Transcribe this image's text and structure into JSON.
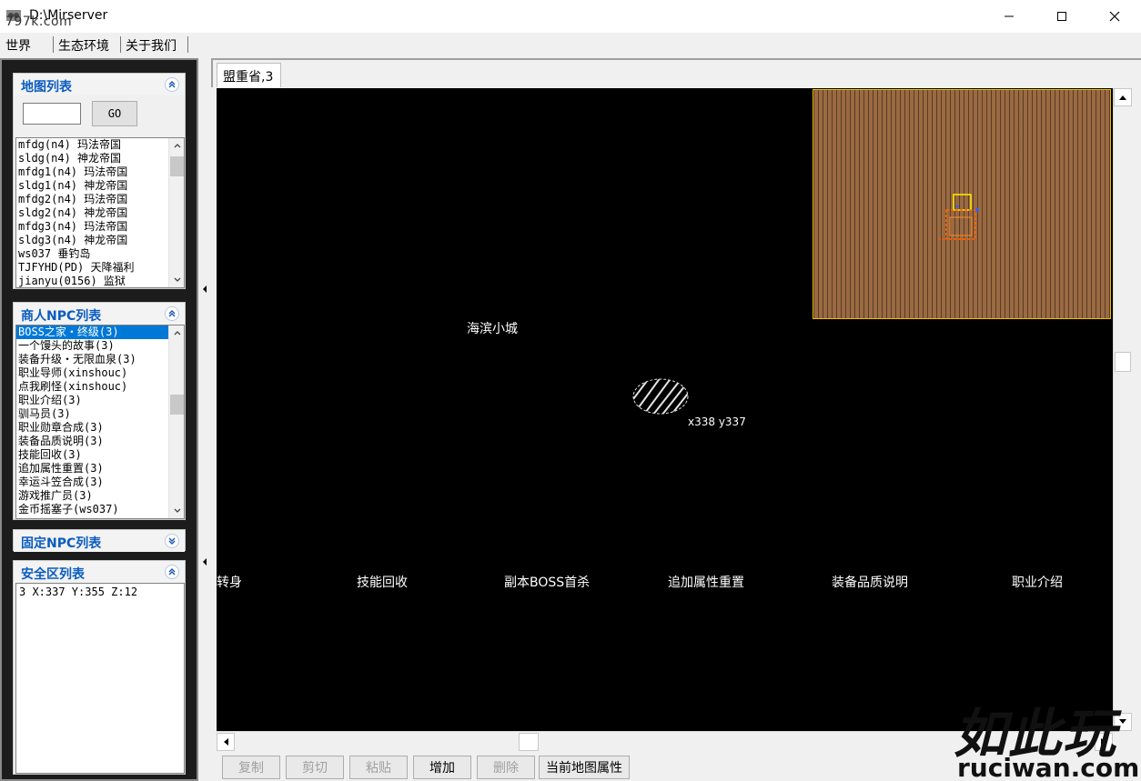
{
  "window": {
    "title": "D:\\Mirserver",
    "watermark_url": "797k.com"
  },
  "menu": [
    "世界",
    "生态环境",
    "关于我们"
  ],
  "map_list": {
    "title": "地图列表",
    "go_label": "GO",
    "items": [
      "mfdg(n4) 玛法帝国",
      "sldg(n4) 神龙帝国",
      "mfdg1(n4) 玛法帝国",
      "sldg1(n4) 神龙帝国",
      "mfdg2(n4) 玛法帝国",
      "sldg2(n4) 神龙帝国",
      "mfdg3(n4) 玛法帝国",
      "sldg3(n4) 神龙帝国",
      "ws037 垂钓岛",
      "TJFYHD(PD) 天降福利",
      "jianyu(0156) 监狱"
    ]
  },
  "merchant_npc": {
    "title": "商人NPC列表",
    "items": [
      "BOSS之家・终级(3)",
      "一个馒头的故事(3)",
      "装备升级・无限血泉(3)",
      "职业导师(xinshouc)",
      "点我刷怪(xinshouc)",
      "职业介绍(3)",
      "驯马员(3)",
      "职业勋章合成(3)",
      "装备品质说明(3)",
      "技能回收(3)",
      "追加属性重置(3)",
      "幸运斗笠合成(3)",
      "游戏推广员(3)",
      "金币摇塞子(ws037)"
    ]
  },
  "fixed_npc": {
    "title": "固定NPC列表"
  },
  "safe_zone": {
    "title": "安全区列表",
    "items": [
      "3 X:337 Y:355 Z:12"
    ]
  },
  "tab": {
    "label": "盟重省,3"
  },
  "map": {
    "town_label": "海滨小城",
    "coord_label": "x338 y337",
    "npc_labels": [
      "转身",
      "技能回收",
      "副本BOSS首杀",
      "追加属性重置",
      "装备品质说明",
      "职业介绍"
    ]
  },
  "toolbar": {
    "copy": "复制",
    "cut": "剪切",
    "paste": "粘贴",
    "add": "增加",
    "delete": "删除",
    "props": "当前地图属性"
  },
  "site_watermark": {
    "big": "如此玩",
    "small": "ruciwan.com"
  }
}
